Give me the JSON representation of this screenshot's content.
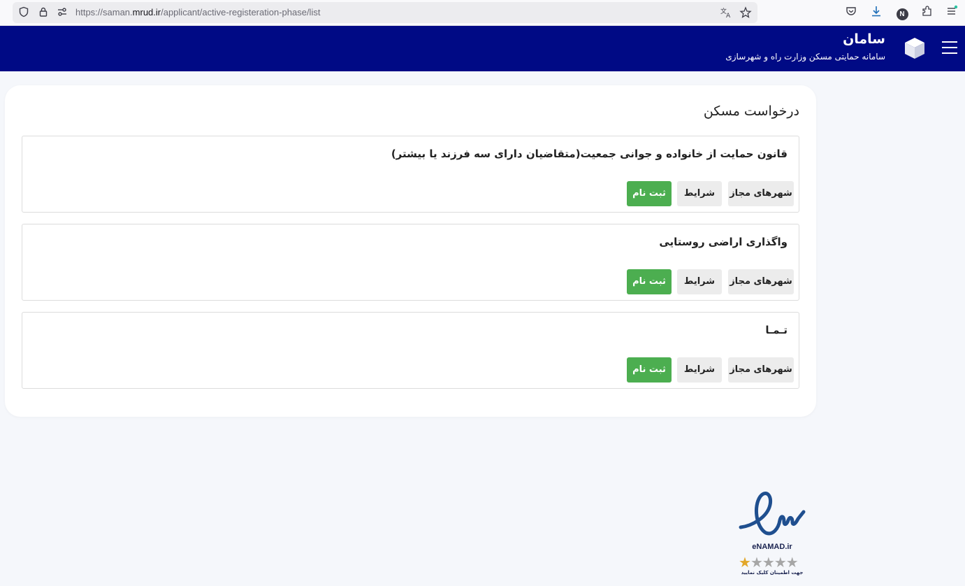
{
  "browser": {
    "url_prefix": "https://saman.",
    "url_domain": "mrud.ir",
    "url_path": "/applicant/active-registeration-phase/list",
    "profile_initial": "N"
  },
  "header": {
    "title": "سامان",
    "subtitle": "سامانه حمایتی مسکن وزارت راه و شهرسازی",
    "background": "#000a85"
  },
  "main": {
    "title": "درخواست مسکن",
    "items": [
      {
        "title": "قانون حمایت از خانواده و جوانی جمعیت(متقاضیان دارای سه فرزند یا بیشتر)",
        "cities_label": "شهرهای مجاز",
        "terms_label": "شرایط",
        "register_label": "ثبت نام"
      },
      {
        "title": "واگذاری اراضی روستایی",
        "cities_label": "شهرهای مجاز",
        "terms_label": "شرایط",
        "register_label": "ثبت نام"
      },
      {
        "title": "تـمـا",
        "cities_label": "شهرهای مجاز",
        "terms_label": "شرایط",
        "register_label": "ثبت نام"
      }
    ],
    "register_color": "#4cae50"
  },
  "enamad": {
    "label": "eNAMAD.ir",
    "rating": 1,
    "max_rating": 5,
    "note": "جهت اطمینان کلیک نمایید"
  }
}
